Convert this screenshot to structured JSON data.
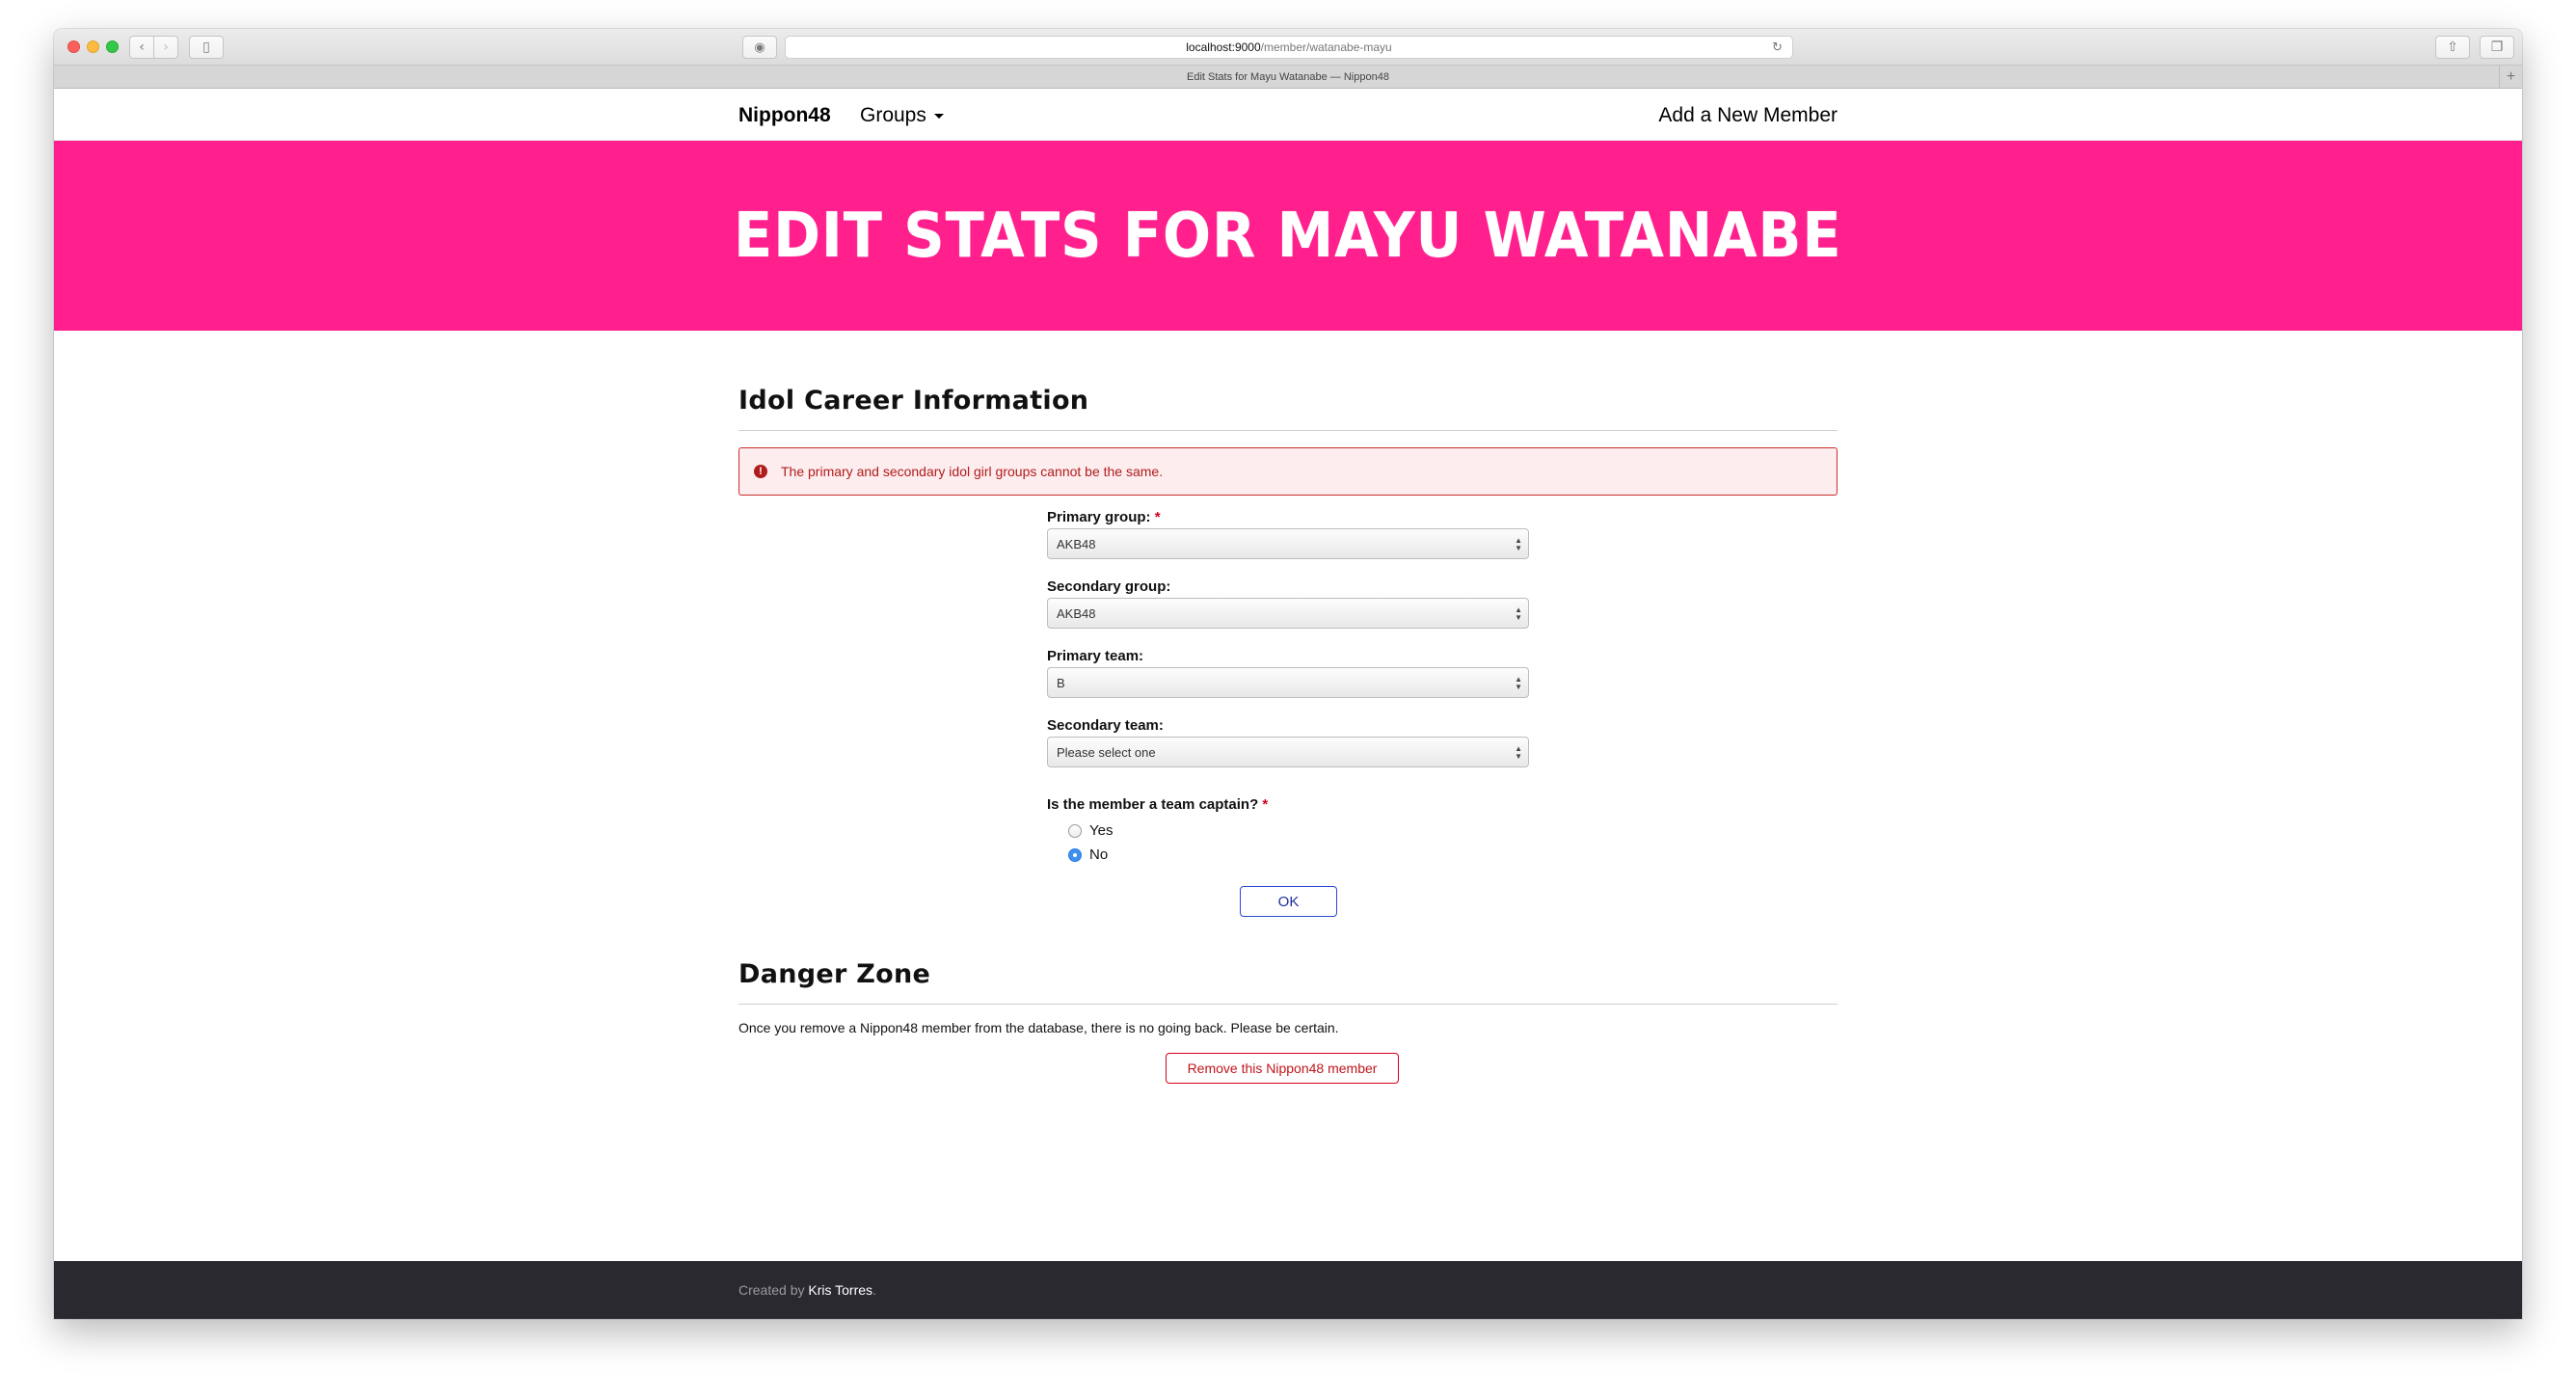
{
  "browser": {
    "url_host": "localhost:9000",
    "url_path": "/member/watanabe-mayu",
    "tab_title": "Edit Stats for Mayu Watanabe — Nippon48"
  },
  "navbar": {
    "brand": "Nippon48",
    "groups_label": "Groups",
    "add_member_label": "Add a New Member"
  },
  "hero": {
    "title": "Edit Stats for Mayu Watanabe",
    "color": "#ff1f8d"
  },
  "career": {
    "heading": "Idol Career Information",
    "alert": "The primary and secondary idol girl groups cannot be the same.",
    "primary_group_label": "Primary group:",
    "primary_group_value": "AKB48",
    "secondary_group_label": "Secondary group:",
    "secondary_group_value": "AKB48",
    "primary_team_label": "Primary team:",
    "primary_team_value": "B",
    "secondary_team_label": "Secondary team:",
    "secondary_team_value": "Please select one",
    "captain_label": "Is the member a team captain?",
    "required_mark": "*",
    "options": [
      {
        "label": "Yes",
        "checked": false
      },
      {
        "label": "No",
        "checked": true
      }
    ],
    "ok_label": "OK"
  },
  "danger": {
    "heading": "Danger Zone",
    "text": "Once you remove a Nippon48 member from the database, there is no going back. Please be certain.",
    "remove_label": "Remove this Nippon48 member"
  },
  "footer": {
    "prefix": "Created by",
    "author": "Kris Torres",
    "suffix": "."
  }
}
